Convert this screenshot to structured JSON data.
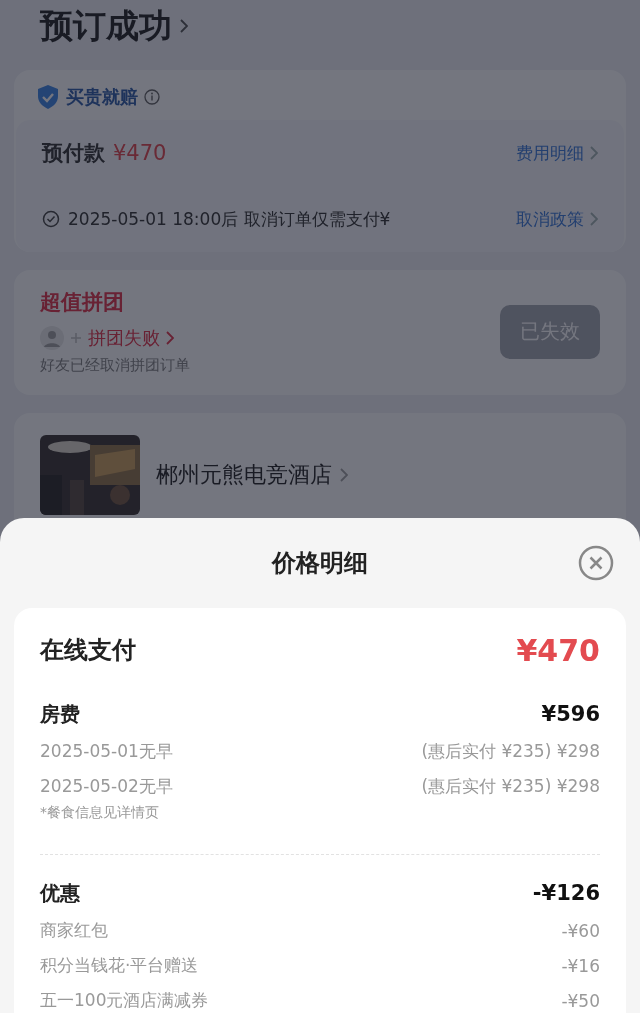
{
  "page": {
    "title": "预订成功",
    "guarantee": {
      "label": "买贵就赔"
    },
    "prepay": {
      "label": "预付款",
      "amount": "¥470",
      "link": "费用明细"
    },
    "cancel": {
      "text": "2025-05-01 18:00后 取消订单仅需支付¥",
      "link": "取消政策"
    },
    "group_buy": {
      "title": "超值拼团",
      "status": "拼团失败",
      "note": "好友已经取消拼团订单",
      "button": {
        "label": "已失效",
        "disabled": true
      }
    },
    "hotel": {
      "name": "郴州元熊电竞酒店"
    }
  },
  "sheet": {
    "title": "价格明细",
    "total": {
      "label": "在线支付",
      "amount": "¥470"
    },
    "sections": [
      {
        "label": "房费",
        "amount": "¥596",
        "items": [
          {
            "label": "2025-05-01无早",
            "amount": "(惠后实付 ¥235) ¥298"
          },
          {
            "label": "2025-05-02无早",
            "amount": "(惠后实付 ¥235) ¥298"
          }
        ],
        "note": "*餐食信息见详情页"
      },
      {
        "label": "优惠",
        "amount": "-¥126",
        "items": [
          {
            "label": "商家红包",
            "amount": "-¥60"
          },
          {
            "label": "积分当钱花·平台赠送",
            "amount": "-¥16"
          },
          {
            "label": "五一100元酒店满减券",
            "amount": "-¥50"
          }
        ]
      }
    ]
  }
}
